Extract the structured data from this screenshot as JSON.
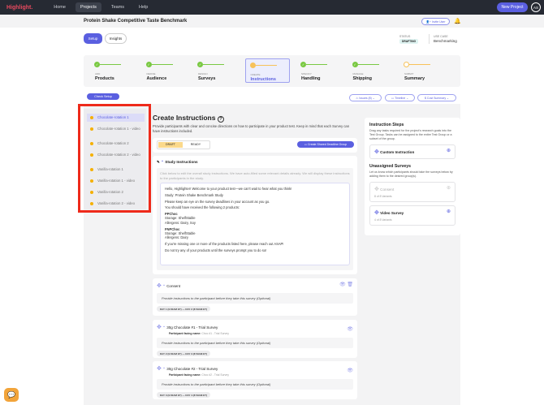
{
  "nav": {
    "logo": "Highlight.",
    "items": [
      "Home",
      "Projects",
      "Teams",
      "Help"
    ],
    "new_project": "New Project",
    "avatar": "AS"
  },
  "header": {
    "title": "Protein Shake Competitive Taste Benchmark",
    "invite": "Invite User"
  },
  "tabs": {
    "setup": "Setup",
    "insights": "Insights"
  },
  "meta": {
    "status_label": "STATUS",
    "status": "DRAFTING",
    "usecase_label": "USE CASE",
    "usecase": "Benchmarking"
  },
  "steps": [
    {
      "k": "ADD",
      "n": "Products"
    },
    {
      "k": "DEFINE",
      "n": "Audience"
    },
    {
      "k": "DESIGN",
      "n": "Surveys"
    },
    {
      "k": "CREATE",
      "n": "Instructions"
    },
    {
      "k": "SPECIFY",
      "n": "Handling"
    },
    {
      "k": "MANAGE",
      "n": "Shipping"
    },
    {
      "k": "SUBMIT",
      "n": "Summary"
    }
  ],
  "toolbar": {
    "check": "Check Setup",
    "issues": "Issues (8)",
    "timeline": "Timeline",
    "cost": "Cost Summary"
  },
  "sidebar": [
    "Chocolate-rotation 1",
    "Chocolate-rotation 1 - video",
    "Chocolate-rotation 2",
    "Chocolate-rotation 2 - video",
    "Vanilla-rotation 1",
    "Vanilla-rotation 1 - video",
    "Vanilla-rotation 2",
    "Vanilla-rotation 2 - video"
  ],
  "main": {
    "title": "Create Instructions",
    "desc": "Provide participants with clear and concise directions on how to participate in your product test. Keep in mind that each Survey can have instructions included.",
    "draft": "DRAFT",
    "ready": "READY",
    "shared": "Create Shared Deadline Group",
    "study_title": "Study Instructions",
    "study_hint": "Click below to edit the overall study instructions. We have auto-filled some relevant details already. We will display these instructions to the participants in the study.",
    "study_lines": [
      "Hello, Highlighter! Welcome to your product test—we can't wait to hear what you think!",
      "Study: Protein Shake Benchmark Study",
      "Please keep an eye on the survey deadlines in your account as you go.",
      "You should have received the following 2 products:"
    ],
    "p1": {
      "name": "PPChoc",
      "storage": "Storage: ShelfStable",
      "allergens": "Allergens: Dairy, Soy"
    },
    "p2": {
      "name": "FNPChoc",
      "storage": "Storage: ShelfStable",
      "allergens": "Allergens: Dairy"
    },
    "closing": [
      "If you're missing one or more of the products listed here, please reach out ASAP!",
      "Do not try any of your products until the surveys prompt you to do so!"
    ],
    "optional": "Provide instructions to the participant before they take this survey (Optional)",
    "pf_label": "Participant facing name:",
    "surveys": [
      {
        "name": "Consent",
        "pf": "",
        "days": "DAY 1 (9:00AM ET) — DAY 2 (8:59AM ET)"
      },
      {
        "name": "30g Chocolate #1 - Trial Survey",
        "pf": "Choc #1 - Trial Survey",
        "days": "DAY 2 (9:00AM ET) — DAY 3 (8:59AM ET)"
      },
      {
        "name": "30g Chocolate #2 - Trial Survey",
        "pf": "Choc #2 - Trial Survey",
        "days": "DAY 3 (9:00AM ET) — DAY 4 (8:59AM ET)"
      }
    ]
  },
  "right": {
    "steps_title": "Instruction Steps",
    "steps_desc": "Drag any tasks required for the project's research goals into the Test Group. Tasks can be assigned to the entire Test Group or a subset of the group.",
    "custom": "Custom Instruction",
    "un_title": "Unassigned Surveys",
    "un_desc": "Let us know which participants should take the surveys below by adding them to the desired group(s).",
    "consent": "Consent",
    "consent_v": "8 of 8 Variants",
    "video": "Video Survey",
    "video_v": "4 of 8 Variants"
  }
}
